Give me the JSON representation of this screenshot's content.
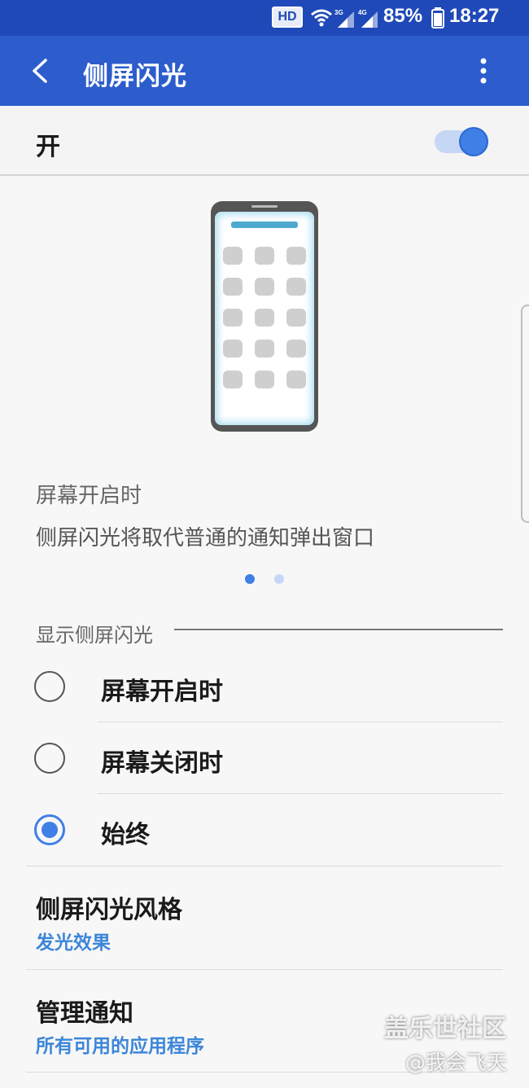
{
  "status_bar": {
    "hd_badge": "HD",
    "wifi_icon": "wifi-icon",
    "signal_3g_label": "3G",
    "signal_4g_label": "4G",
    "battery_percent": "85%",
    "battery_icon": "battery-icon",
    "time": "18:27",
    "color": "#1f49b8"
  },
  "app_bar": {
    "title": "侧屏闪光",
    "back_icon": "back-arrow-icon",
    "more_icon": "more-vert-icon",
    "color": "#2d5dcd"
  },
  "master_switch": {
    "label": "开",
    "state": "on",
    "accent": "#3f7fe6"
  },
  "preview": {
    "illustration": "phone-edge-lighting-illustration",
    "title": "屏幕开启时",
    "description": "侧屏闪光将取代普通的通知弹出窗口",
    "page_count": 2,
    "active_page": 1
  },
  "display_section": {
    "label": "显示侧屏闪光",
    "options": [
      {
        "label": "屏幕开启时",
        "selected": false
      },
      {
        "label": "屏幕关闭时",
        "selected": false
      },
      {
        "label": "始终",
        "selected": true
      }
    ]
  },
  "settings": [
    {
      "title": "侧屏闪光风格",
      "subtitle": "发光效果"
    },
    {
      "title": "管理通知",
      "subtitle": "所有可用的应用程序"
    }
  ],
  "watermark": {
    "site": "盖乐世社区",
    "user": "@我会飞天"
  }
}
